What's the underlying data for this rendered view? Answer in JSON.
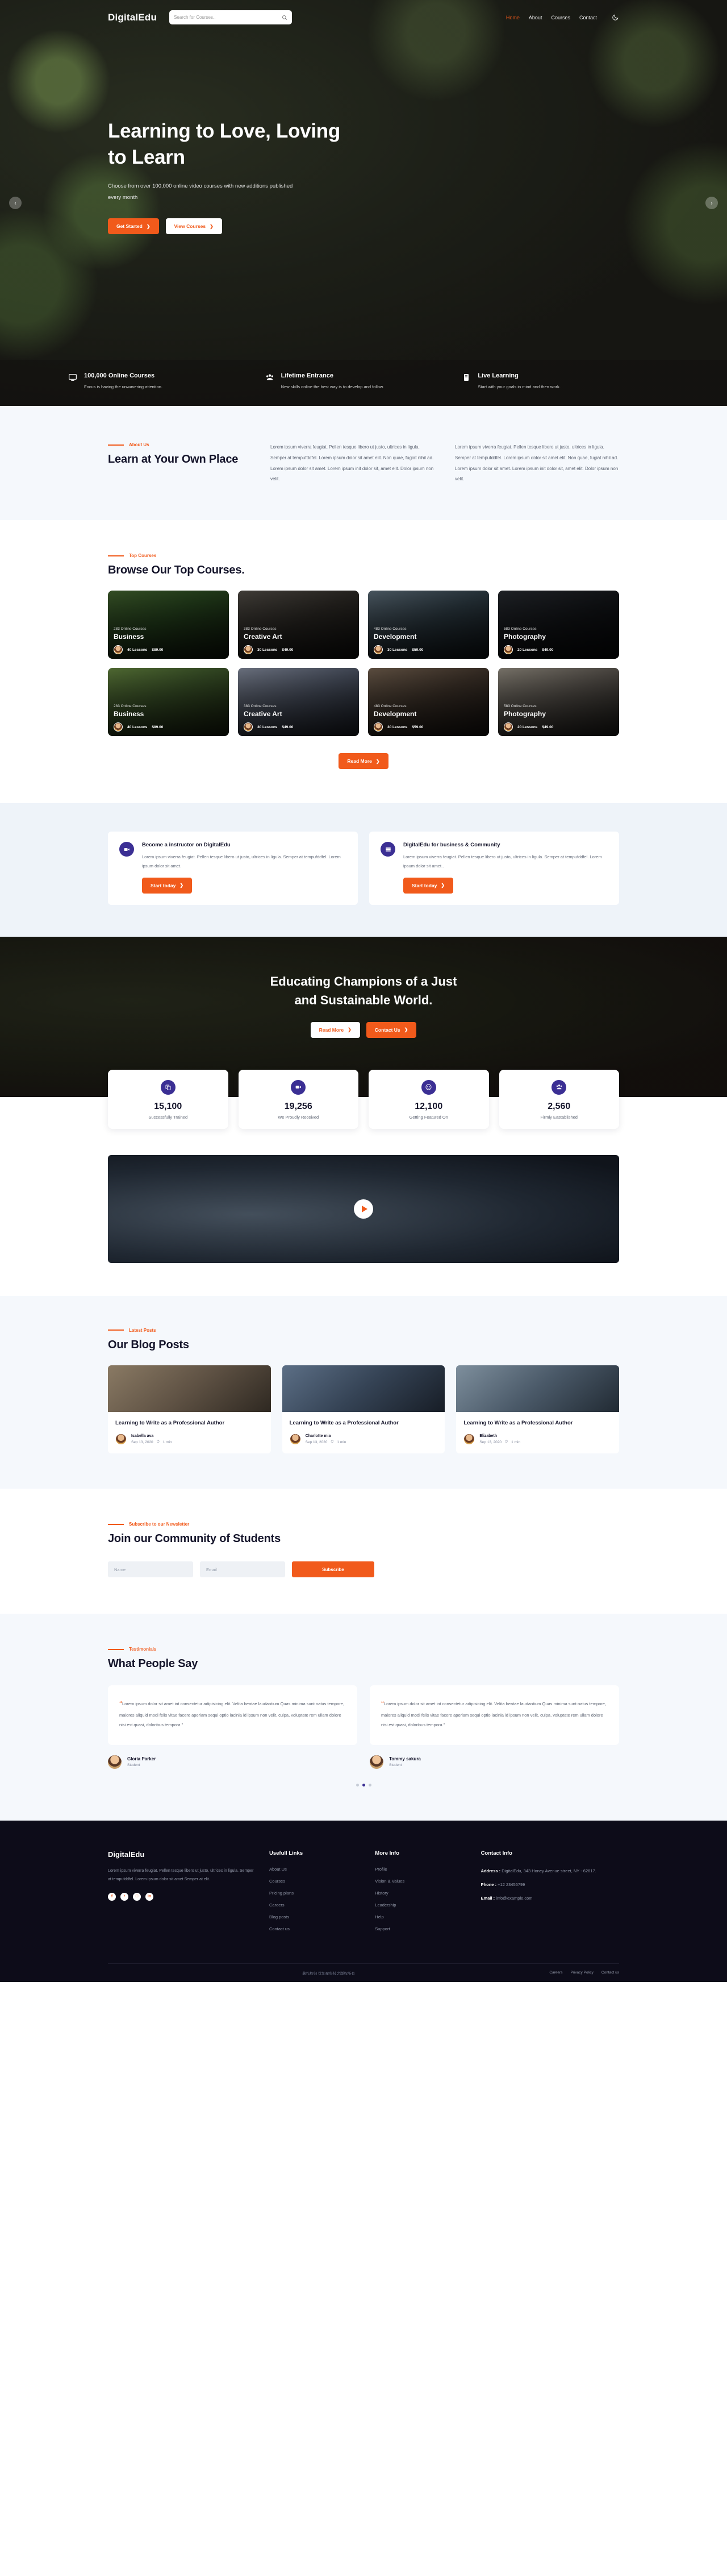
{
  "brand": {
    "name": "DigitalEdu",
    "accent_color": "#f15a1b",
    "purple": "#3b2f94"
  },
  "header": {
    "logo": "DigitalEdu",
    "search_placeholder": "Search for Courses..",
    "nav": [
      {
        "label": "Home",
        "active": true
      },
      {
        "label": "About",
        "active": false
      },
      {
        "label": "Courses",
        "active": false
      },
      {
        "label": "Contact",
        "active": false
      }
    ],
    "theme_toggle": "moon-icon"
  },
  "hero": {
    "title": "Learning to Love, Loving to Learn",
    "subtitle": "Choose from over 100,000 online video courses with new additions published every month",
    "primary_btn": "Get Started",
    "secondary_btn": "View Courses",
    "prev_arrow": "‹",
    "next_arrow": "›",
    "features": [
      {
        "icon": "monitor-icon",
        "title": "100,000 Online Courses",
        "desc": "Focus is having the unwavering attention."
      },
      {
        "icon": "users-icon",
        "title": "Lifetime Entrance",
        "desc": "New skills online the best way is to develop and follow."
      },
      {
        "icon": "book-icon",
        "title": "Live Learning",
        "desc": "Start with your goals in mind and then work."
      }
    ]
  },
  "about": {
    "eyebrow": "About Us",
    "title": "Learn at Your Own Place",
    "paragraph_1": "Lorem ipsum viverra feugiat. Pellen tesque libero ut justo, ultrices in ligula. Semper at tempufddfel. Lorem ipsum dolor sit amet elit. Non quae, fugiat nihil ad. Lorem ipsum dolor sit amet. Lorem ipsum init dolor sit, amet elit. Dolor ipsum non velit.",
    "paragraph_2": "Lorem ipsum viverra feugiat. Pellen tesque libero ut justo, ultrices in ligula. Semper at tempufddfel. Lorem ipsum dolor sit amet elit. Non quae, fugiat nihil ad. Lorem ipsum dolor sit amet. Lorem ipsum init dolor sit, amet elit. Dolor ipsum non velit."
  },
  "courses": {
    "eyebrow": "Top Courses",
    "title": "Browse Our Top Courses.",
    "read_more": "Read More",
    "items": [
      {
        "count": "283 Online Courses",
        "name": "Business",
        "lessons": "40 Lessons",
        "price": "$89.00",
        "img": "ph-biz"
      },
      {
        "count": "383 Online Courses",
        "name": "Creative Art",
        "lessons": "30 Lessons",
        "price": "$49.00",
        "img": "ph-art"
      },
      {
        "count": "483 Online Courses",
        "name": "Development",
        "lessons": "30 Lessons",
        "price": "$59.00",
        "img": "ph-dev"
      },
      {
        "count": "583 Online Courses",
        "name": "Photography",
        "lessons": "20 Lessons",
        "price": "$49.00",
        "img": "ph-photo"
      },
      {
        "count": "283 Online Courses",
        "name": "Business",
        "lessons": "40 Lessons",
        "price": "$89.00",
        "img": "ph-biz2"
      },
      {
        "count": "383 Online Courses",
        "name": "Creative Art",
        "lessons": "30 Lessons",
        "price": "$49.00",
        "img": "ph-art2"
      },
      {
        "count": "483 Online Courses",
        "name": "Development",
        "lessons": "30 Lessons",
        "price": "$59.00",
        "img": "ph-dev2"
      },
      {
        "count": "583 Online Courses",
        "name": "Photography",
        "lessons": "20 Lessons",
        "price": "$49.00",
        "img": "ph-photo2"
      }
    ]
  },
  "promo": {
    "cards": [
      {
        "icon": "video-camera-icon",
        "title": "Become a instructor on DigitalEdu",
        "desc": "Lorem ipsum viverra feugiat. Pellen tesque libero ut justo, ultrices in ligula. Semper at tempufddfel. Lorem ipsum dolor sit amet.",
        "btn": "Start today"
      },
      {
        "icon": "list-icon",
        "title": "DigitalEdu for business & Community",
        "desc": "Lorem ipsum viverra feugiat. Pellen tesque libero ut justo, ultrices in ligula. Semper at tempufddfel. Lorem ipsum dolor sit amet..",
        "btn": "Start today"
      }
    ]
  },
  "banner": {
    "title_line_1": "Educating Champions of a Just",
    "title_line_2": "and Sustainable World.",
    "read_more": "Read More",
    "contact_us": "Contact Us"
  },
  "stats": [
    {
      "icon": "copy-icon",
      "number": "15,100",
      "label": "Successfully Trained"
    },
    {
      "icon": "video-icon",
      "number": "19,256",
      "label": "We Proudly Received"
    },
    {
      "icon": "smile-icon",
      "number": "12,100",
      "label": "Getting Featured On"
    },
    {
      "icon": "people-icon",
      "number": "2,560",
      "label": "Firmly Eastablished"
    }
  ],
  "video": {
    "play_label": "play-button"
  },
  "blog": {
    "eyebrow": "Latest Posts",
    "title": "Our Blog Posts",
    "posts": [
      {
        "title": "Learning to Write as a Professional Author",
        "author": "Isabella ava",
        "date": "Sep 13, 2020",
        "read": "1 min",
        "img": "ph-b1"
      },
      {
        "title": "Learning to Write as a Professional Author",
        "author": "Charlotte mia",
        "date": "Sep 13, 2020",
        "read": "1 min",
        "img": "ph-b2"
      },
      {
        "title": "Learning to Write as a Professional Author",
        "author": "Elizabeth",
        "date": "Sep 13, 2020",
        "read": "1 min",
        "img": "ph-b3"
      }
    ]
  },
  "newsletter": {
    "eyebrow": "Subscribe to our Newsletter",
    "title": "Join our Community of Students",
    "name_placeholder": "Name",
    "email_placeholder": "Email",
    "submit": "Subscribe"
  },
  "testimonials": {
    "eyebrow": "Testimonials",
    "title": "What People Say",
    "items": [
      {
        "quote": "Lorem ipsum dolor sit amet int consectetur adipisicing elit. Velita beatae laudantium Quas minima sunt natus tempore, maiores aliquid modi felis vitae facere aperiam sequi optio lacinia id ipsum non velit, culpa, voluptate rem ullam dolore nisi est quasi, doloribus tempora.\"",
        "name": "Gloria Parker",
        "role": "Student"
      },
      {
        "quote": "Lorem ipsum dolor sit amet int consectetur adipisicing elit. Velita beatae laudantium Quas minima sunt natus tempore, maiores aliquid modi felis vitae facere aperiam sequi optio lacinia id ipsum non velit, culpa, voluptate rem ullam dolore nisi est quasi, doloribus tempora.\"",
        "name": "Tommy sakura",
        "role": "Student"
      }
    ]
  },
  "footer": {
    "logo": "DigitalEdu",
    "about": "Lorem ipsum viverra feugiat. Pellen tesque libero ut justo, ultrices in ligula. Semper at tempufddfel. Lorem ipsum dolor sit amet Semper at elit.",
    "social": [
      {
        "icon": "facebook-icon",
        "glyph": "f"
      },
      {
        "icon": "twitter-icon",
        "glyph": "ᵛ"
      },
      {
        "icon": "instagram-icon",
        "glyph": "□"
      },
      {
        "icon": "linkedin-icon",
        "glyph": "in"
      }
    ],
    "useful_links": {
      "heading": "Usefull Links",
      "items": [
        "About Us",
        "Courses",
        "Pricing plans",
        "Careers",
        "Blog posts",
        "Contact us"
      ]
    },
    "more_info": {
      "heading": "More Info",
      "items": [
        "Profile",
        "Vision & Values",
        "History",
        "Leadership",
        "Help",
        "Support"
      ]
    },
    "contact": {
      "heading": "Contact Info",
      "address_label": "Address :",
      "address_value": "DigitalEdu, 343 Honey Avenue street, NY - 62617.",
      "phone_label": "Phone :",
      "phone_value": "+12 23456799",
      "email_label": "Email :",
      "email_value": "info@example.com"
    },
    "copyright": "著作权归 优加星科技之版权所有",
    "bottom_links": [
      "Careers",
      "Privacy Policy",
      "Contact us"
    ]
  }
}
